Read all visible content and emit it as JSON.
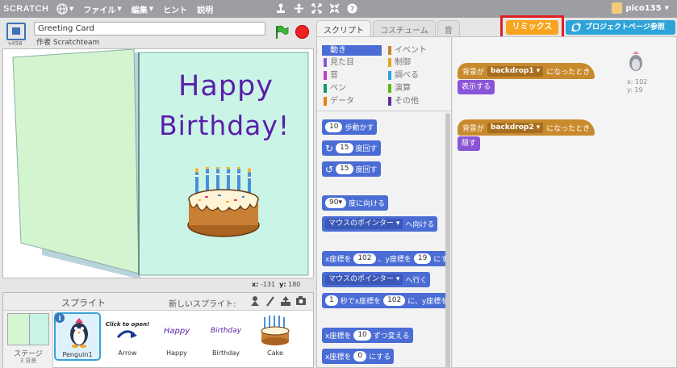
{
  "menubar": {
    "logo": "SCRATCH",
    "file": "ファイル",
    "edit": "編集",
    "tips": "ヒント",
    "about": "説明",
    "username": "pico135"
  },
  "stage_header": {
    "project_title": "Greeting Card",
    "author": "作者 Scratchteam",
    "version": "v458"
  },
  "stage": {
    "card_line1": "Happy",
    "card_line2": "Birthday!",
    "mouse_x_label": "x:",
    "mouse_x": "-131",
    "mouse_y_label": "y:",
    "mouse_y": "180"
  },
  "sprites_panel": {
    "title": "スプライト",
    "new_sprite": "新しいスプライト:",
    "stage_label": "ステージ",
    "stage_backdrops": "3 背景",
    "sprites": [
      {
        "name": "Penguin1",
        "selected": true
      },
      {
        "name": "Arrow",
        "thumb_text": "Click to open!"
      },
      {
        "name": "Happy",
        "thumb_text": "Happy"
      },
      {
        "name": "Birthday",
        "thumb_text": "Birthday"
      },
      {
        "name": "Cake"
      }
    ]
  },
  "tabs": [
    "スクリプト",
    "コスチューム",
    "音"
  ],
  "buttons": {
    "remix": "リミックス",
    "see_project_page": "プロジェクトページ参照"
  },
  "categories": [
    {
      "label": "動き",
      "color": "#4a6cd4",
      "active": true
    },
    {
      "label": "見た目",
      "color": "#8a55d7"
    },
    {
      "label": "音",
      "color": "#bb42c3"
    },
    {
      "label": "ペン",
      "color": "#0e9a6c"
    },
    {
      "label": "データ",
      "color": "#ee7d16"
    },
    {
      "label": "イベント",
      "color": "#c88330"
    },
    {
      "label": "制御",
      "color": "#e1a91a"
    },
    {
      "label": "調べる",
      "color": "#2ca5e2"
    },
    {
      "label": "演算",
      "color": "#5cb712"
    },
    {
      "label": "その他",
      "color": "#632d99"
    }
  ],
  "palette_blocks": {
    "move_steps": {
      "value": "10",
      "label": "歩動かす"
    },
    "turn_right": {
      "value": "15",
      "label": "度回す"
    },
    "turn_left": {
      "value": "15",
      "label": "度回す"
    },
    "point_direction": {
      "value": "90▾",
      "label": "度に向ける"
    },
    "point_towards": {
      "dropdown": "マウスのポインター",
      "label": "へ向ける"
    },
    "go_to_xy": {
      "prefix": "x座標を",
      "x": "102",
      "mid": "、y座標を",
      "y": "19",
      "suffix": "にす"
    },
    "go_to": {
      "dropdown": "マウスのポインター",
      "label": "へ行く"
    },
    "glide": {
      "secs": "1",
      "prefix": "秒でx座標を",
      "x": "102",
      "mid": "に、y座標を"
    },
    "change_x": {
      "prefix": "x座標を",
      "value": "10",
      "suffix": "ずつ変える"
    },
    "set_x": {
      "prefix": "x座標を",
      "value": "0",
      "suffix": "にする"
    }
  },
  "scripts": [
    {
      "hat_prefix": "背景が",
      "backdrop": "backdrop1",
      "hat_suffix": "になったとき",
      "action": "表示する"
    },
    {
      "hat_prefix": "背景が",
      "backdrop": "backdrop2",
      "hat_suffix": "になったとき",
      "action": "隠す"
    }
  ],
  "sprite_info": {
    "x_label": "x:",
    "x": "102",
    "y_label": "y:",
    "y": "19"
  }
}
